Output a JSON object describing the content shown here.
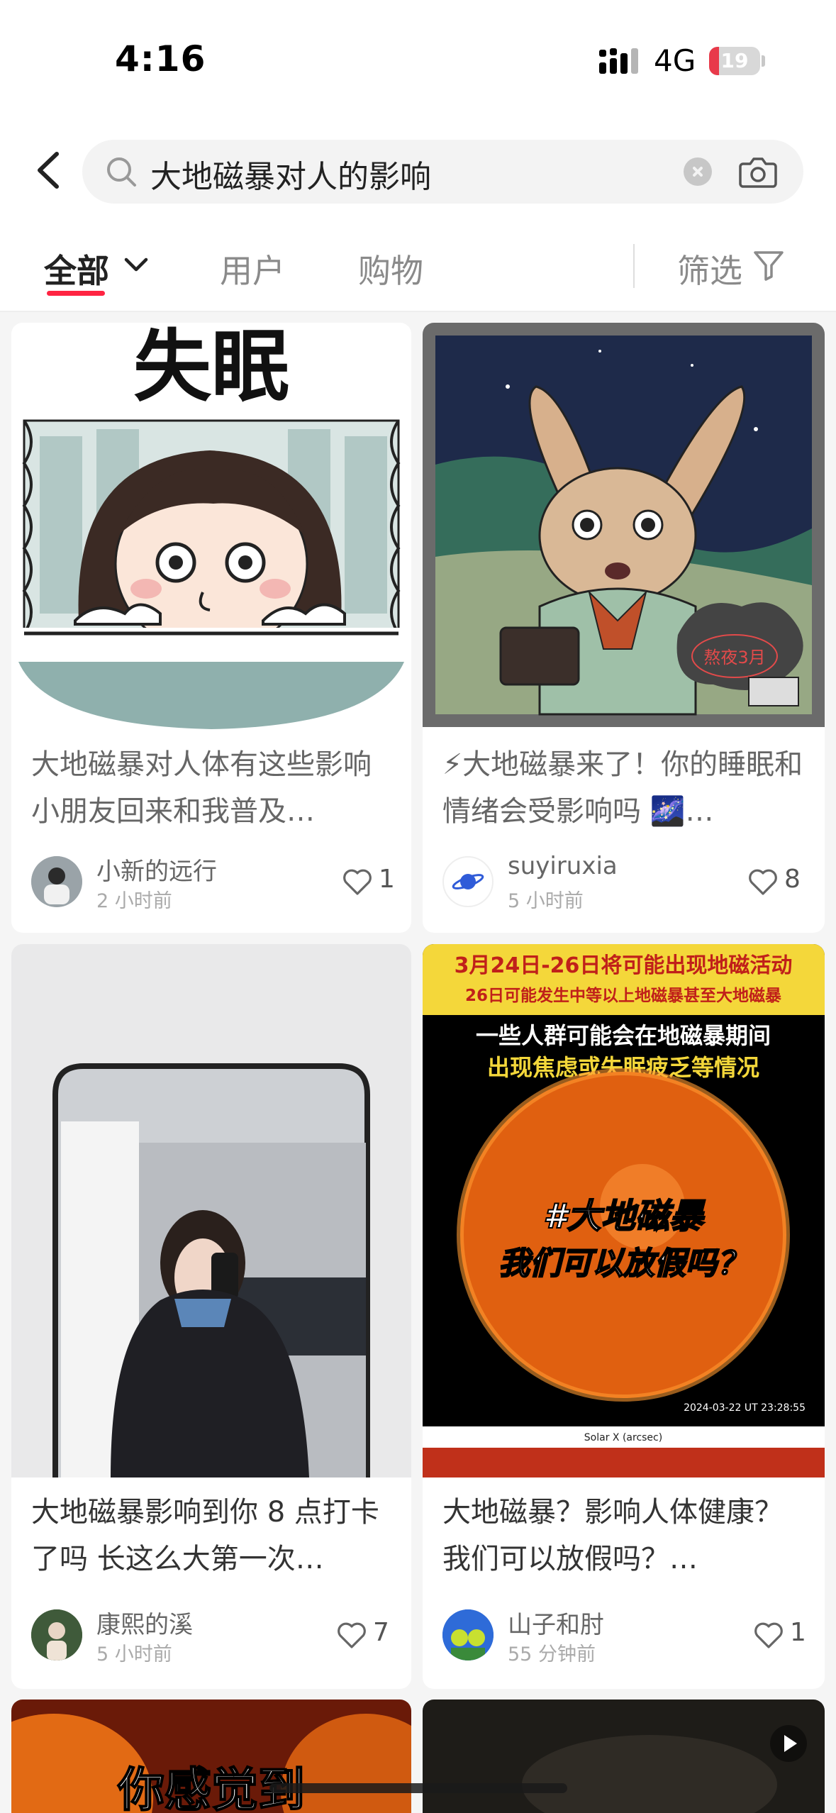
{
  "status": {
    "time": "4:16",
    "network": "4G",
    "battery": "19",
    "battery_level": 0.19
  },
  "search": {
    "query": "大地磁暴对人的影响"
  },
  "tabs": [
    {
      "label": "全部"
    },
    {
      "label": "用户"
    },
    {
      "label": "购物"
    }
  ],
  "filter_label": "筛选",
  "icons": [
    "back-arrow-icon",
    "search-icon",
    "clear-icon",
    "camera-icon",
    "chevron-down-icon",
    "filter-funnel-icon",
    "heart-icon",
    "play-icon",
    "signal-icon"
  ],
  "colors": {
    "accent": "#ff2442"
  },
  "cards": [
    {
      "image_text": "失眠",
      "title": "大地磁暴对人体有这些影响 小朋友回来和我普及…",
      "author": "小新的远行",
      "posted": "2 小时前",
      "likes": "1"
    },
    {
      "image_text": "",
      "badge_text": "熬夜3月",
      "title": "⚡大地磁暴来了！你的睡眠和情绪会受影响吗 🌌…",
      "author": "suyiruxia",
      "posted": "5 小时前",
      "likes": "8"
    },
    {
      "image_text": "",
      "title": "大地磁暴影响到你 8 点打卡了吗 长这么大第一次…",
      "author": "康熙的溪",
      "posted": "5 小时前",
      "likes": "7"
    },
    {
      "image_banner_1": "3月24日-26日将可能出现地磁活动",
      "image_banner_2": "26日可能发生中等以上地磁暴甚至大地磁暴",
      "image_subtitle_1": "一些人群可能会在地磁暴期间",
      "image_subtitle_2": "出现焦虑或失眠疲乏等情况",
      "image_center_1": "#大地磁暴",
      "image_center_2": "我们可以放假吗？",
      "image_timestamp": "2024-03-22 UT 23:28:55",
      "image_axis_label": "Solar X (arcsec)",
      "title": "大地磁暴？影响人体健康？我们可以放假吗？…",
      "author": "山子和肘",
      "posted": "55 分钟前",
      "likes": "1"
    },
    {
      "image_text": "你感觉到"
    },
    {
      "image_text": ""
    }
  ]
}
